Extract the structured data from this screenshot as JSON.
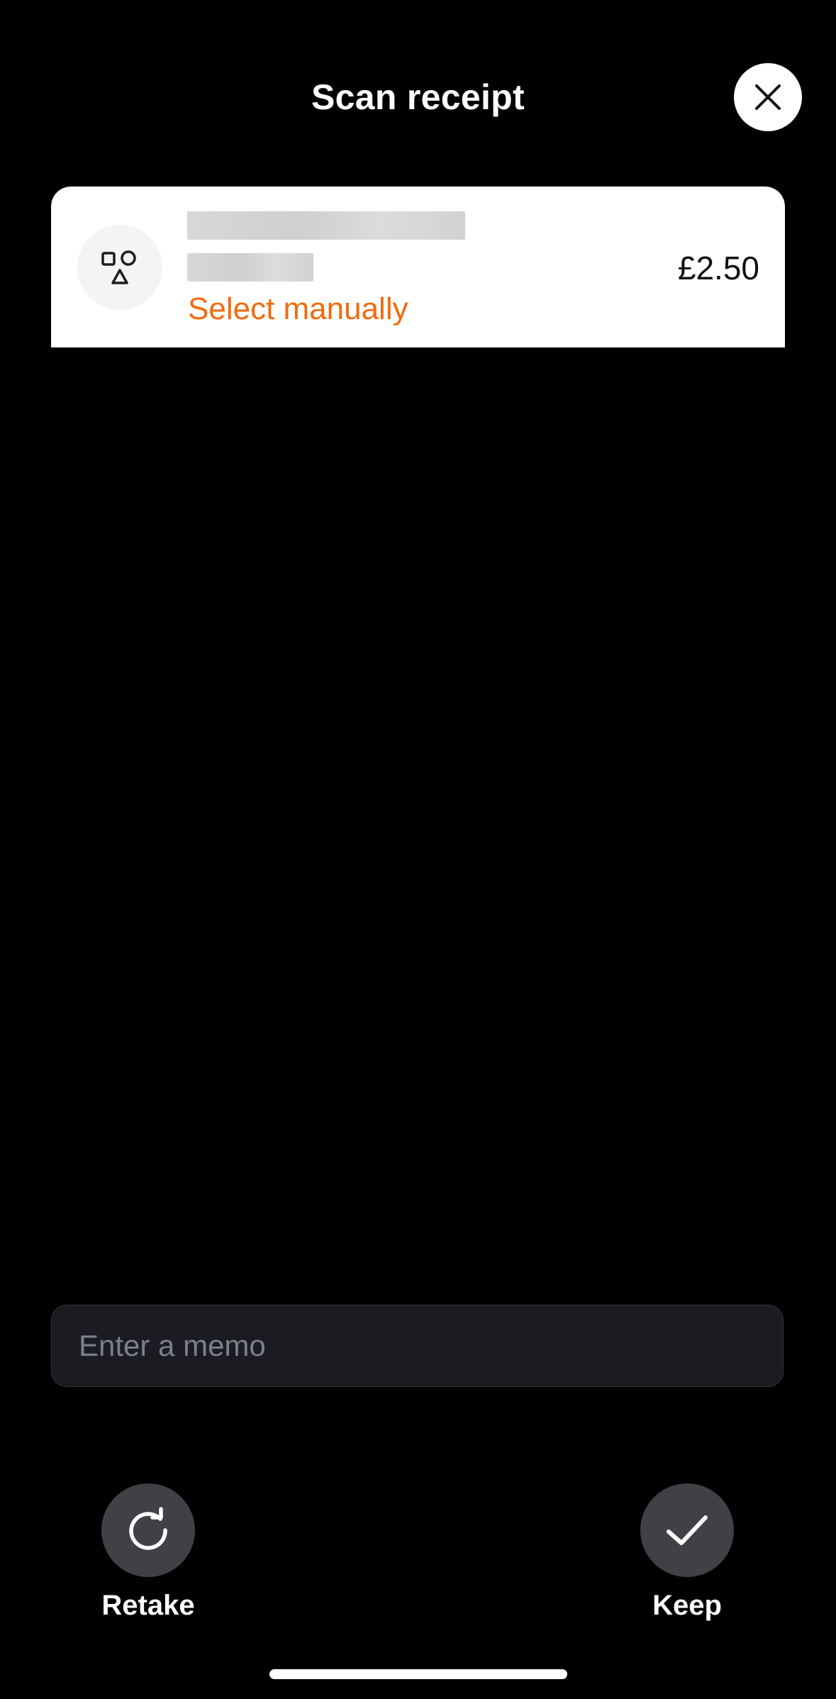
{
  "header": {
    "title": "Scan receipt",
    "close_icon": "close-icon"
  },
  "receipt": {
    "category_icon": "shapes-icon",
    "select_manually": "Select manually",
    "amount": "£2.50",
    "accent_color": "#f26b10"
  },
  "memo": {
    "placeholder": "Enter a memo",
    "value": ""
  },
  "actions": {
    "retake_label": "Retake",
    "retake_icon": "refresh-icon",
    "keep_label": "Keep",
    "keep_icon": "checkmark-icon"
  }
}
